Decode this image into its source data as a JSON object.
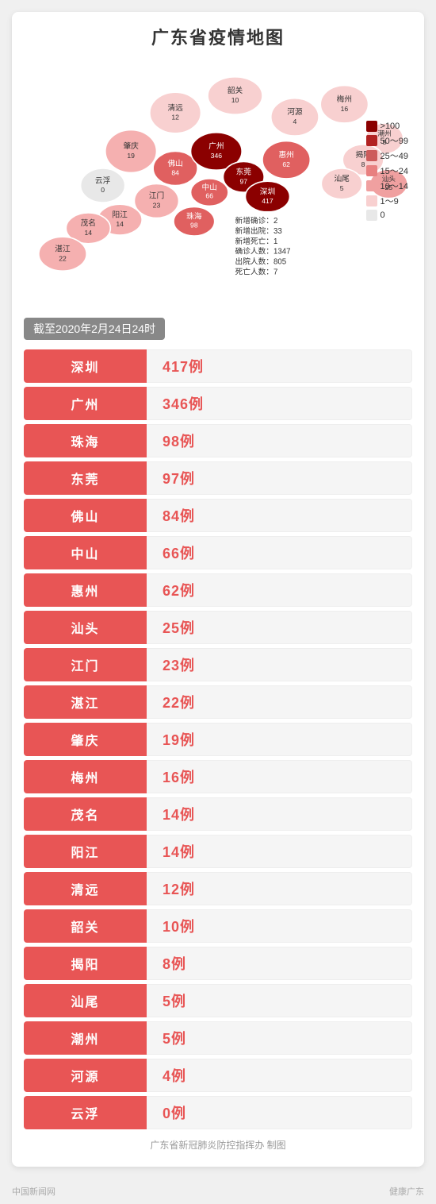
{
  "page": {
    "title": "广东省疫情地图",
    "date_badge": "截至2020年2月24日24时",
    "footer": "广东省新冠肺炎防控指挥办  制图"
  },
  "stats": {
    "new_confirmed_label": "新增确诊：",
    "new_confirmed_value": "2",
    "new_discharged_label": "新增出院：",
    "new_discharged_value": "33",
    "new_death_label": "新增死亡：",
    "new_death_value": "1",
    "total_confirmed_label": "确诊人数：",
    "total_confirmed_value": "1347",
    "total_discharged_label": "出院人数：",
    "total_discharged_value": "805",
    "total_death_label": "死亡人数：",
    "total_death_value": "7"
  },
  "legend": [
    {
      "label": ">100",
      "color": "#8b0000"
    },
    {
      "label": "50～99",
      "color": "#b22222"
    },
    {
      "label": "25～49",
      "color": "#cd5c5c"
    },
    {
      "label": "15～24",
      "color": "#e88080"
    },
    {
      "label": "10～14",
      "color": "#f0a0a0"
    },
    {
      "label": "1～9",
      "color": "#f8d0d0"
    },
    {
      "label": "0",
      "color": "#e8e8e8"
    }
  ],
  "cities": [
    {
      "name": "深圳",
      "count": "417例"
    },
    {
      "name": "广州",
      "count": "346例"
    },
    {
      "name": "珠海",
      "count": "98例"
    },
    {
      "name": "东莞",
      "count": "97例"
    },
    {
      "name": "佛山",
      "count": "84例"
    },
    {
      "name": "中山",
      "count": "66例"
    },
    {
      "name": "惠州",
      "count": "62例"
    },
    {
      "name": "汕头",
      "count": "25例"
    },
    {
      "name": "江门",
      "count": "23例"
    },
    {
      "name": "湛江",
      "count": "22例"
    },
    {
      "name": "肇庆",
      "count": "19例"
    },
    {
      "name": "梅州",
      "count": "16例"
    },
    {
      "name": "茂名",
      "count": "14例"
    },
    {
      "name": "阳江",
      "count": "14例"
    },
    {
      "name": "清远",
      "count": "12例"
    },
    {
      "name": "韶关",
      "count": "10例"
    },
    {
      "name": "揭阳",
      "count": "8例"
    },
    {
      "name": "汕尾",
      "count": "5例"
    },
    {
      "name": "潮州",
      "count": "5例"
    },
    {
      "name": "河源",
      "count": "4例"
    },
    {
      "name": "云浮",
      "count": "0例"
    }
  ],
  "bottom_left": "中国新闻网",
  "bottom_right": "健康广东"
}
